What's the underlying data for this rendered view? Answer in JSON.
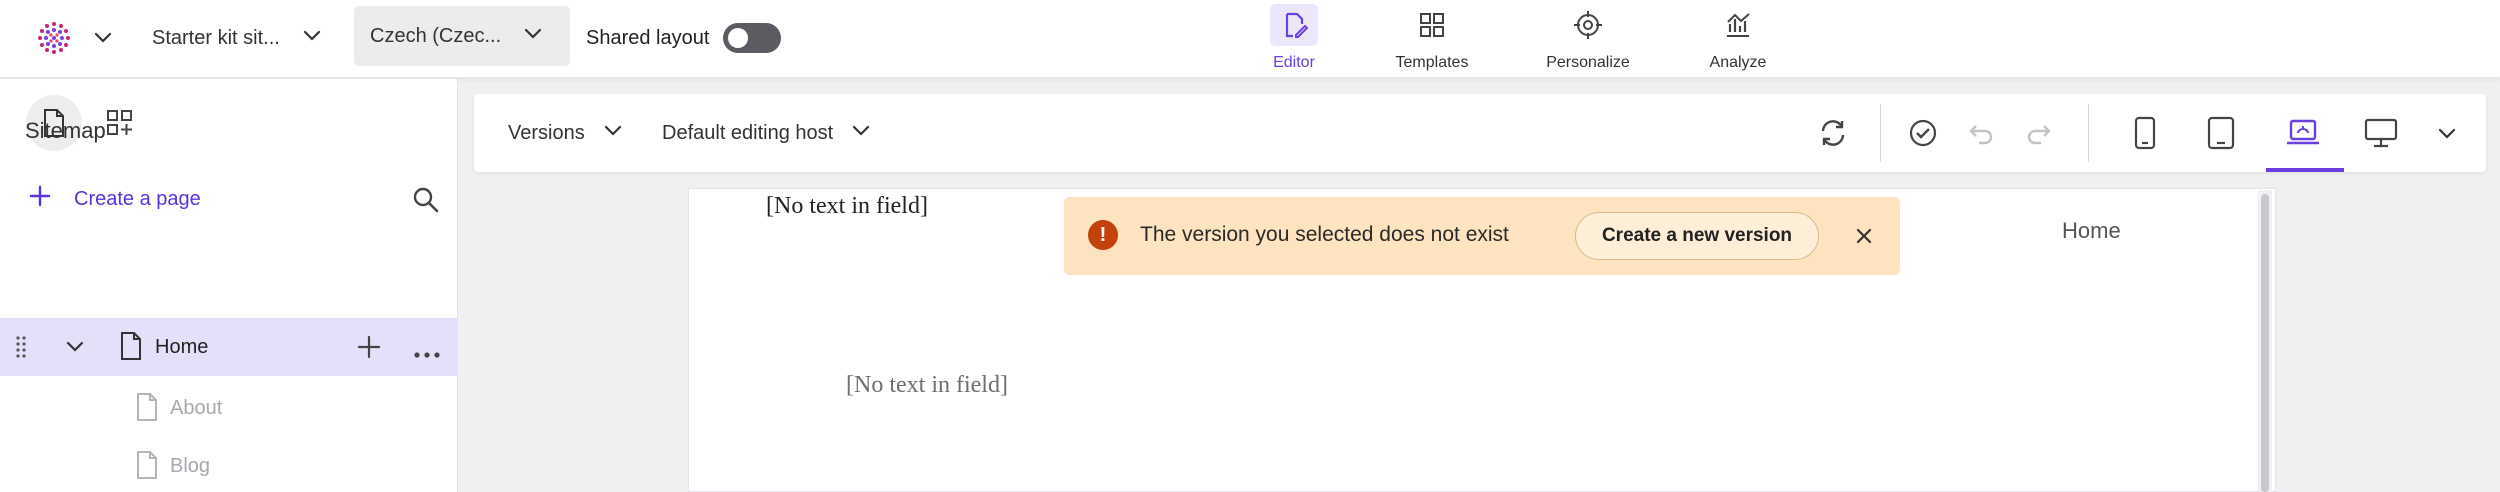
{
  "topbar": {
    "site_name": "Starter kit sit...",
    "language": "Czech (Czec...",
    "shared_layout_label": "Shared layout",
    "shared_layout_on": false,
    "nav": [
      {
        "label": "Editor",
        "icon": "edit-page-icon",
        "active": true
      },
      {
        "label": "Templates",
        "icon": "templates-grid-icon",
        "active": false
      },
      {
        "label": "Personalize",
        "icon": "target-icon",
        "active": false
      },
      {
        "label": "Analyze",
        "icon": "analytics-icon",
        "active": false
      }
    ],
    "accent_color": "#6b3fe0"
  },
  "sidebar": {
    "title": "Sitemap",
    "create_page": "Create a page",
    "tree": [
      {
        "label": "Home",
        "selected": true,
        "level": 0
      },
      {
        "label": "About",
        "selected": false,
        "level": 1
      },
      {
        "label": "Blog",
        "selected": false,
        "level": 1
      }
    ]
  },
  "toolbar": {
    "versions": "Versions",
    "editing_host": "Default editing host",
    "devices": [
      "phone-icon",
      "tablet-icon",
      "laptop-icon",
      "desktop-icon"
    ],
    "active_device": "laptop-icon"
  },
  "canvas": {
    "field_top": "[No text in field]",
    "field_body": "[No text in field]",
    "home_link": "Home"
  },
  "toast": {
    "message": "The version you selected does not exist",
    "action": "Create a new version",
    "color": "#fde3bf"
  }
}
